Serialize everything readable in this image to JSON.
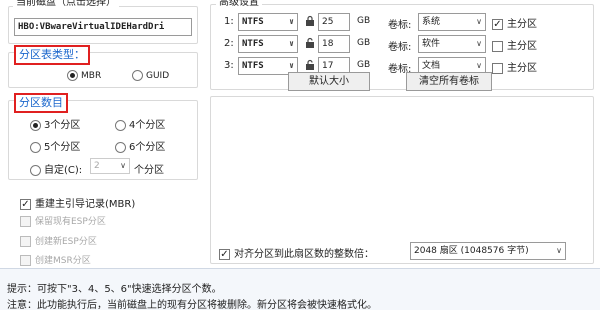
{
  "disk_section": {
    "legend": "当前磁盘（点击选择）",
    "disk_value": "HBO:VBwareVirtualIDEHardDri"
  },
  "partition_table": {
    "label": "分区表类型：",
    "options": [
      "MBR",
      "GUID"
    ],
    "selected": "MBR"
  },
  "partition_count": {
    "label": "分区数目",
    "options": [
      "3个分区",
      "4个分区",
      "5个分区",
      "6个分区"
    ],
    "selected": "3个分区",
    "custom_label": "自定(C):",
    "custom_value": "2",
    "custom_suffix": "个分区"
  },
  "checkboxes": [
    {
      "label": "重建主引导记录(MBR)",
      "checked": true,
      "enabled": true
    },
    {
      "label": "保留现有ESP分区",
      "checked": false,
      "enabled": false
    },
    {
      "label": "创建新ESP分区",
      "checked": false,
      "enabled": false
    },
    {
      "label": "创建MSR分区",
      "checked": false,
      "enabled": false
    }
  ],
  "hdd_section": {
    "legend": "高级设置",
    "rows": [
      {
        "index": "1:",
        "fs": "NTFS",
        "size": "25",
        "unit": "GB",
        "volume_label": "卷标:",
        "name": "系统",
        "primary": true,
        "primary_label": "主分区"
      },
      {
        "index": "2:",
        "fs": "NTFS",
        "size": "18",
        "unit": "GB",
        "volume_label": "卷标:",
        "name": "软件",
        "primary": false,
        "primary_label": "主分区"
      },
      {
        "index": "3:",
        "fs": "NTFS",
        "size": "17",
        "unit": "GB",
        "volume_label": "卷标:",
        "name": "文档",
        "primary": false,
        "primary_label": "主分区"
      }
    ],
    "default_size_button": "默认大小",
    "clear_labels_button": "清空所有卷标"
  },
  "align": {
    "label": "对齐分区到此扇区数的整数倍：",
    "checked": true,
    "value": "2048 扇区 (1048576 字节)"
  },
  "footer": {
    "hint": "提示：可按下\"3、4、5、6\"快速选择分区个数。",
    "warning": "注意：此功能执行后，当前磁盘上的现有分区将被删除。新分区将会被快速格式化。"
  },
  "colors": {
    "accent_text": "#1a66cc",
    "highlight_border": "#e02020"
  },
  "icons": {
    "lock": "lock-icon",
    "unlock": "unlock-icon",
    "dropdown": "chevron-down-icon"
  }
}
